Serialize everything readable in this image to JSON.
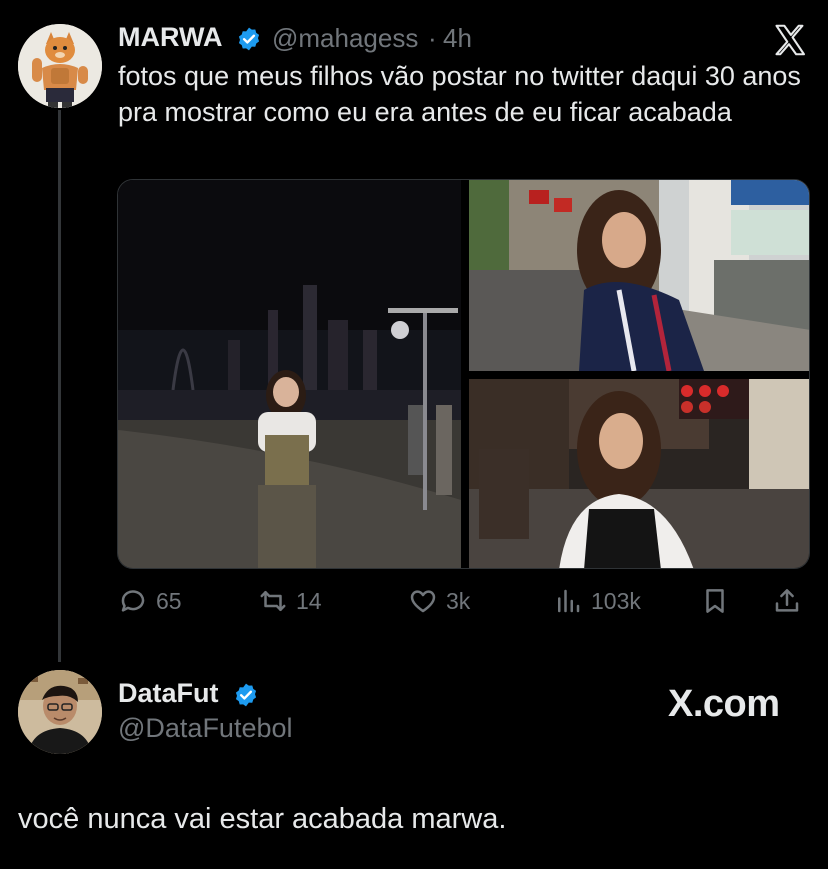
{
  "tweet": {
    "author_name": "MARWA",
    "author_handle": "@mahagess",
    "separator": "·",
    "time": "4h",
    "text": "fotos que meus filhos vão postar no twitter daqui 30 anos pra mostrar como eu era antes de eu ficar acabada",
    "avatar_icon": "cat-avatar-icon",
    "verified_color": "#1d9bf0",
    "close_icon": "x-logo-icon",
    "media": [
      {
        "name": "photo-night-waterfront"
      },
      {
        "name": "photo-street-day"
      },
      {
        "name": "photo-street-night"
      }
    ],
    "actions": {
      "replies": "65",
      "retweets": "14",
      "likes": "3k",
      "views": "103k"
    }
  },
  "reply": {
    "author_name": "DataFut",
    "author_handle": "@DataFutebol",
    "brand": "X.com",
    "text": "você nunca vai estar acabada marwa.",
    "avatar_icon": "person-avatar-icon"
  },
  "colors": {
    "background": "#000000",
    "text": "#e7e9ea",
    "muted": "#71767b",
    "accent": "#1d9bf0"
  }
}
